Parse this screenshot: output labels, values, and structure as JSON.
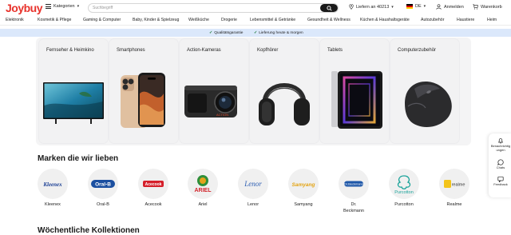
{
  "header": {
    "logo": "Joybuy",
    "categories_label": "Kategorien",
    "search_placeholder": "Suchbegriff",
    "deliver_label": "Liefern an 40213",
    "language": "DE",
    "login_label": "Anmelden",
    "cart_label": "Warenkorb"
  },
  "nav": {
    "items": [
      "Elektronik",
      "Kosmetik & Pflege",
      "Gaming & Computer",
      "Baby, Kinder & Spielzeug",
      "Weißküche",
      "Drogerie",
      "Lebensmittel & Getränke",
      "Gesundheit & Wellness",
      "Küchen & Haushaltsgeräte",
      "Autozubehör",
      "Haustiere",
      "Heim"
    ]
  },
  "benefits": {
    "items": [
      "Qualitätsgarantie",
      "Lieferung heute & morgen"
    ]
  },
  "categories": {
    "cards": [
      {
        "title": "Fernseher & Heimkino",
        "icon": "tv-icon"
      },
      {
        "title": "Smartphones",
        "icon": "smartphone-icon"
      },
      {
        "title": "Action-Kameras",
        "icon": "action-camera-icon"
      },
      {
        "title": "Kopfhörer",
        "icon": "headphones-icon"
      },
      {
        "title": "Tablets",
        "icon": "tablet-icon"
      },
      {
        "title": "Computerzubehör",
        "icon": "mouse-icon"
      }
    ]
  },
  "brands": {
    "title": "Marken die wir lieben",
    "items": [
      {
        "name": "Kleenex",
        "logo_text": "Kleenex",
        "color": "#1b3f94"
      },
      {
        "name": "Oral-B",
        "logo_text": "Oral-B",
        "color": "#1b4fa0"
      },
      {
        "name": "Acecook",
        "logo_text": "Acecook",
        "color": "#d5202b"
      },
      {
        "name": "Ariel",
        "logo_text": "ARIEL",
        "color": "#d2232a"
      },
      {
        "name": "Lenor",
        "logo_text": "Lenor",
        "color": "#2e5fb3"
      },
      {
        "name": "Samyang",
        "logo_text": "Samyang",
        "color": "#e3a312"
      },
      {
        "name": "Dr.\nBeckmann",
        "logo_text": "Dr.Beckmann",
        "color": "#1e57a8"
      },
      {
        "name": "Purcotton",
        "logo_text": "Purcotton",
        "color": "#1aa39a"
      },
      {
        "name": "Realme",
        "logo_text": "realme",
        "color": "#f3c41a"
      }
    ]
  },
  "next_section": {
    "title": "Wöchentliche Kollektionen"
  },
  "side_widget": {
    "items": [
      {
        "label": "Benachrichtigungen",
        "icon": "bell-icon"
      },
      {
        "label": "Chats",
        "icon": "chat-icon"
      },
      {
        "label": "Feedback",
        "icon": "feedback-icon"
      }
    ]
  },
  "colors": {
    "brand": "#e8322b",
    "benefit_strip": "#dbe8fb",
    "card_bg": "#f2f2f3"
  }
}
